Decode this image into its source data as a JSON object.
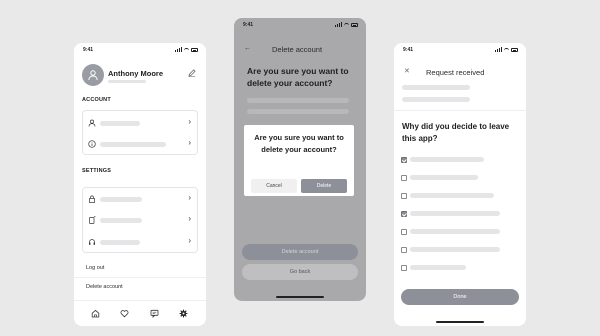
{
  "screens": {
    "profile": {
      "status_time": "9:41",
      "user_name": "Anthony Moore",
      "section_account": "ACCOUNT",
      "section_settings": "SETTINGS",
      "logout_label": "Log out",
      "delete_label": "Delete account",
      "icons": {
        "avatar": "user-icon",
        "edit": "pencil-icon",
        "account_rows": [
          "user-icon",
          "info-icon"
        ],
        "settings_rows": [
          "lock-icon",
          "phone-icon",
          "headset-icon"
        ],
        "tabs": [
          "home-icon",
          "heart-icon",
          "chat-icon",
          "gear-icon"
        ]
      }
    },
    "delete": {
      "status_time": "9:41",
      "title": "Delete account",
      "question": "Are you sure you want to delete your account?",
      "dialog_question": "Are you sure you want to delete your account?",
      "cancel_label": "Cancel",
      "confirm_label": "Delete",
      "delete_button_label": "Delete account",
      "back_button_label": "Go back"
    },
    "request": {
      "status_time": "9:41",
      "title": "Request received",
      "question": "Why did you decide to leave this app?",
      "options_checked": [
        true,
        false,
        false,
        true,
        false,
        false,
        false
      ],
      "done_label": "Done"
    }
  },
  "colors": {
    "background": "#e9e9ea",
    "overlay": "#a9a9ab",
    "primary_button": "#8e9099",
    "placeholder": "#e5e5e8"
  }
}
